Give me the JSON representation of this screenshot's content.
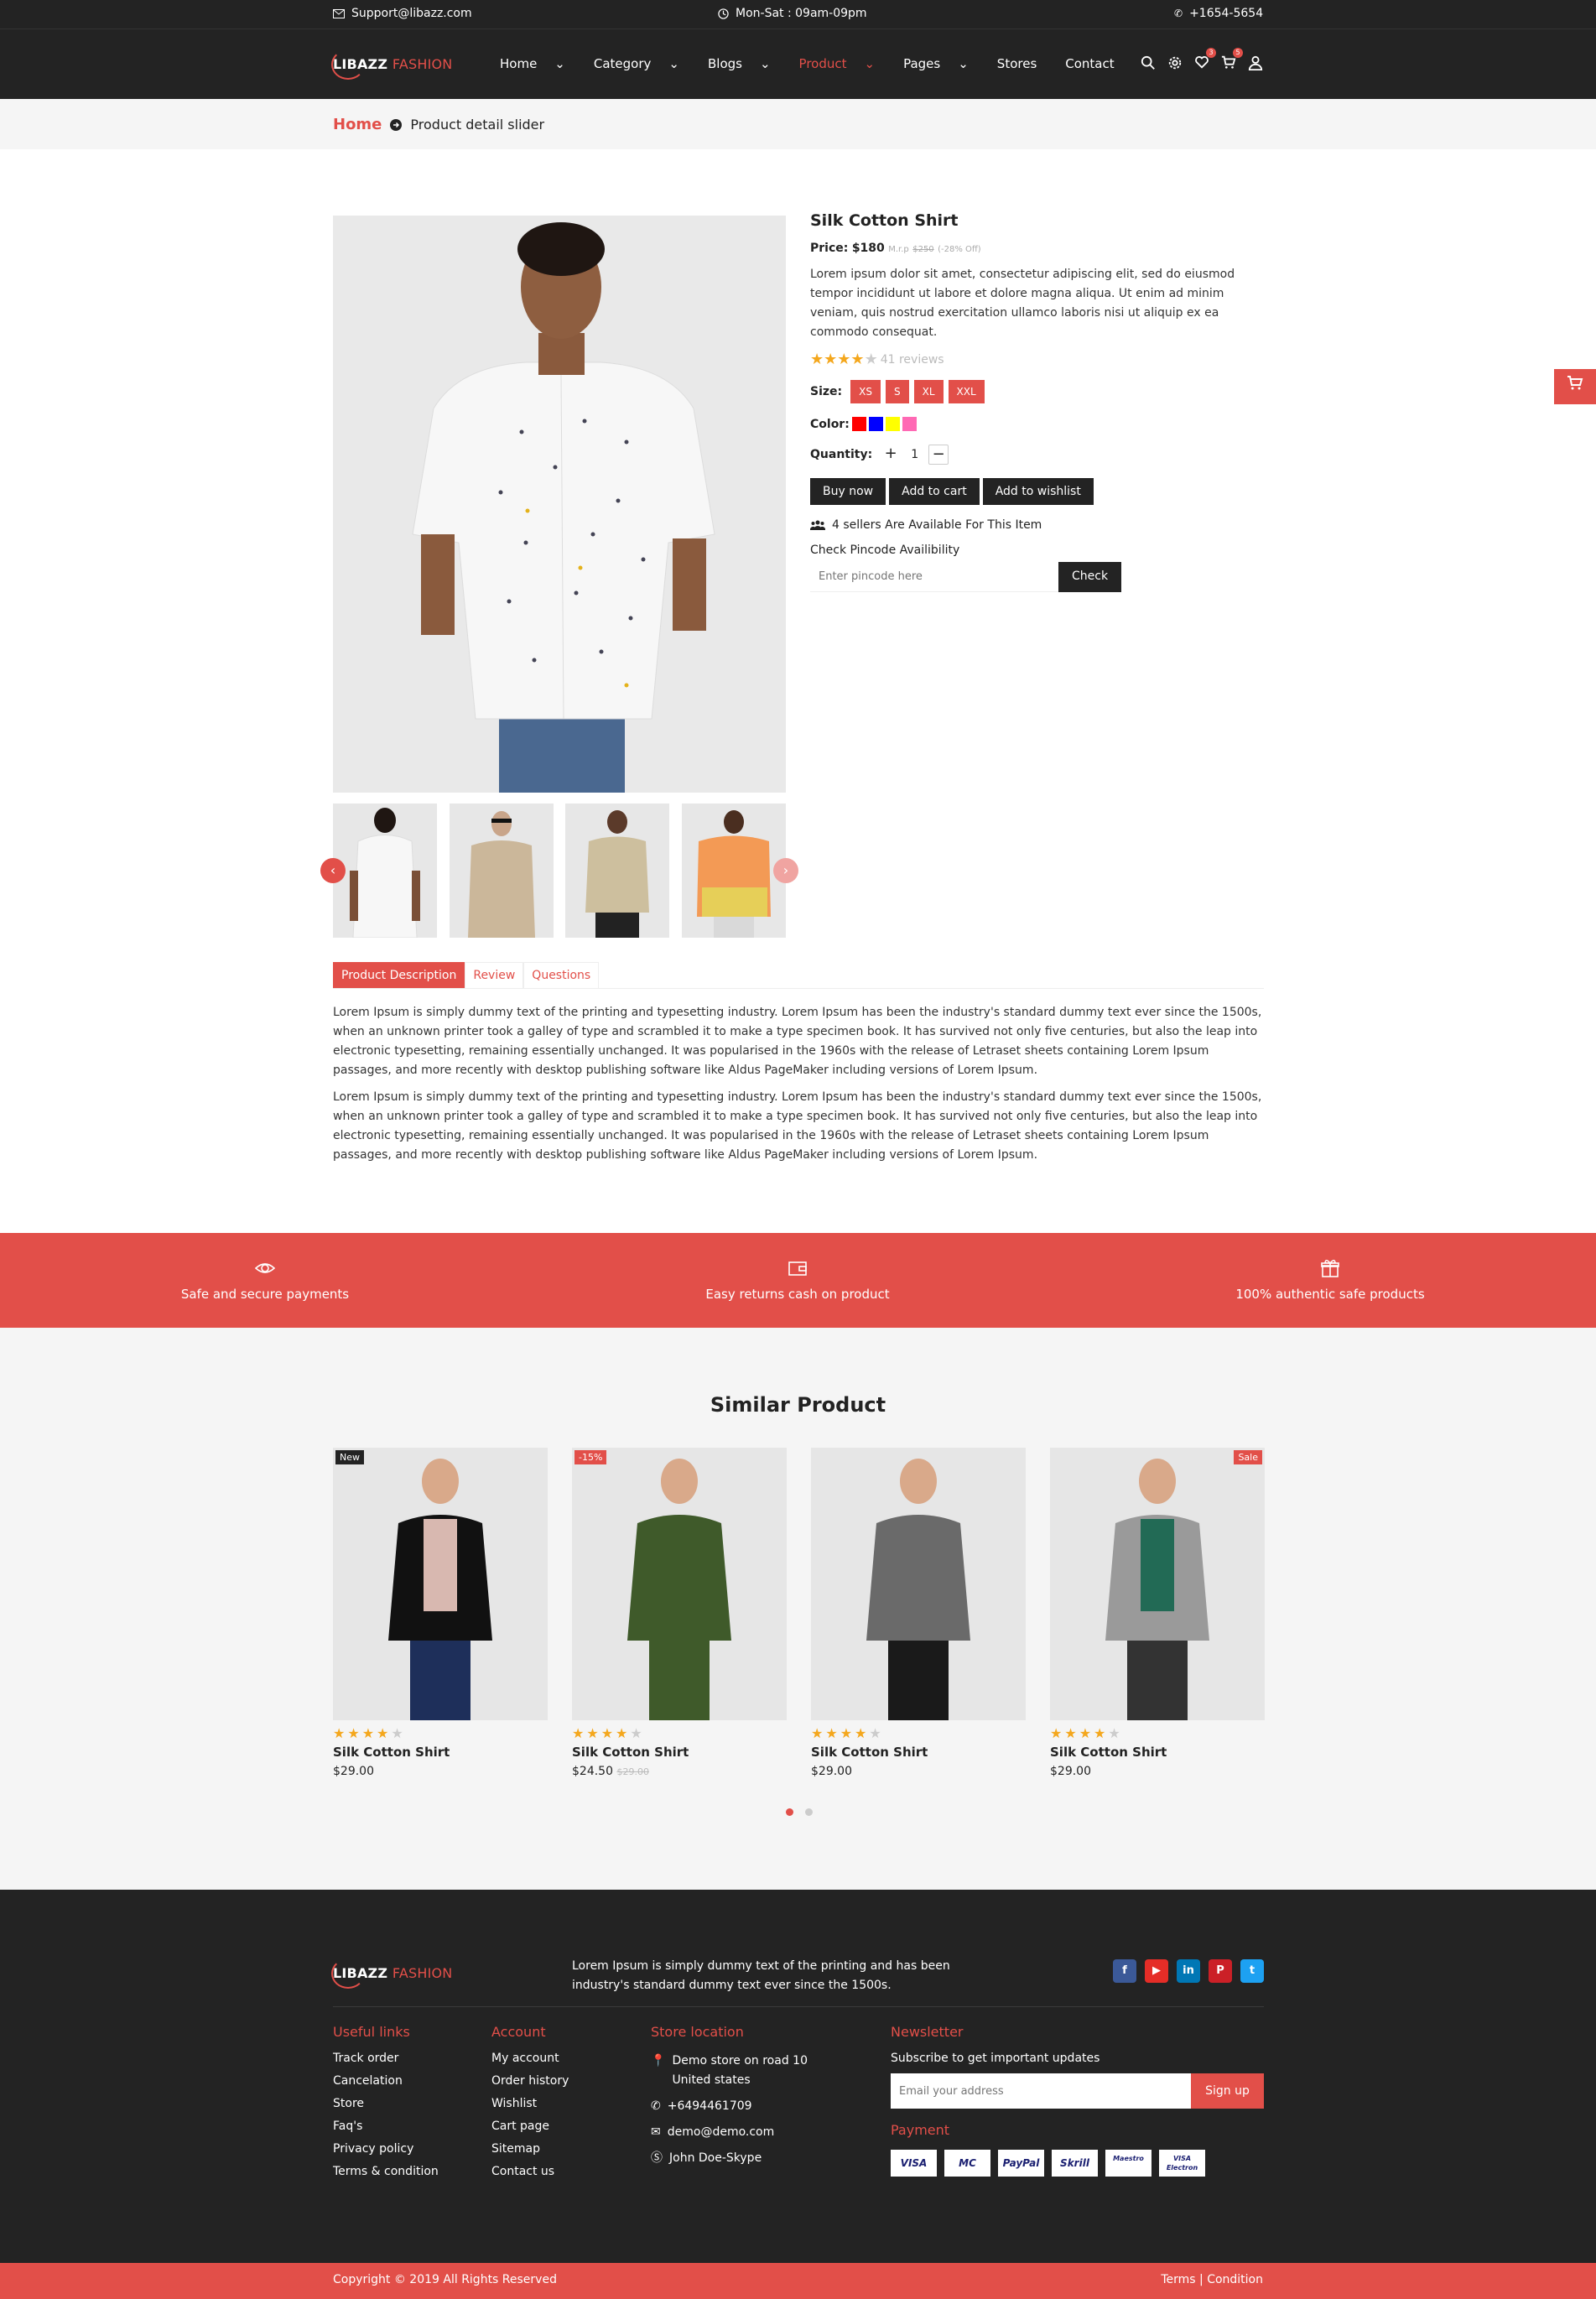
{
  "topbar": {
    "email": "Support@libazz.com",
    "hours": "Mon-Sat : 09am-09pm",
    "phone": "+1654-5654"
  },
  "header": {
    "logo_a": "LIBAZZ",
    "logo_b": "FASHION",
    "nav": [
      {
        "label": "Home",
        "dropdown": true
      },
      {
        "label": "Category",
        "dropdown": true
      },
      {
        "label": "Blogs",
        "dropdown": true
      },
      {
        "label": "Product",
        "dropdown": true,
        "active": true
      },
      {
        "label": "Pages",
        "dropdown": true
      },
      {
        "label": "Stores",
        "dropdown": false
      },
      {
        "label": "Contact",
        "dropdown": false
      }
    ],
    "wishlist_count": "3",
    "cart_count": "5"
  },
  "breadcrumb": {
    "home": "Home",
    "current": "Product detail slider"
  },
  "product": {
    "title": "Silk Cotton Shirt",
    "price_label": "Price:",
    "price": "$180",
    "mrp_label": "M.r.p",
    "old_price": "$250",
    "discount": "(-28% Off)",
    "description": "Lorem ipsum dolor sit amet, consectetur adipiscing elit, sed do eiusmod tempor incididunt ut labore et dolore magna aliqua. Ut enim ad minim veniam, quis nostrud exercitation ullamco laboris nisi ut aliquip ex ea commodo consequat.",
    "rating": 4,
    "reviews": "41 reviews",
    "size_label": "Size:",
    "sizes": [
      "XS",
      "S",
      "XL",
      "XXL"
    ],
    "color_label": "Color:",
    "colors": [
      "#ff0000",
      "#0000ff",
      "#ffff00",
      "#ff69b4"
    ],
    "quantity_label": "Quantity:",
    "quantity": "1",
    "buttons": {
      "buy": "Buy now",
      "cart": "Add to cart",
      "wishlist": "Add to wishlist"
    },
    "sellers": "4 sellers Are Available For This Item",
    "pincode_label": "Check Pincode Availibility",
    "pincode_placeholder": "Enter pincode here",
    "pincode_button": "Check"
  },
  "tabs": {
    "items": [
      "Product Description",
      "Review",
      "Questions"
    ],
    "paragraphs": [
      "Lorem Ipsum is simply dummy text of the printing and typesetting industry. Lorem Ipsum has been the industry's standard dummy text ever since the 1500s, when an unknown printer took a galley of type and scrambled it to make a type specimen book. It has survived not only five centuries, but also the leap into electronic typesetting, remaining essentially unchanged. It was popularised in the 1960s with the release of Letraset sheets containing Lorem Ipsum passages, and more recently with desktop publishing software like Aldus PageMaker including versions of Lorem Ipsum.",
      "Lorem Ipsum is simply dummy text of the printing and typesetting industry. Lorem Ipsum has been the industry's standard dummy text ever since the 1500s, when an unknown printer took a galley of type and scrambled it to make a type specimen book. It has survived not only five centuries, but also the leap into electronic typesetting, remaining essentially unchanged. It was popularised in the 1960s with the release of Letraset sheets containing Lorem Ipsum passages, and more recently with desktop publishing software like Aldus PageMaker including versions of Lorem Ipsum."
    ]
  },
  "features": [
    {
      "icon": "eye-icon",
      "label": "Safe and secure payments"
    },
    {
      "icon": "wallet-icon",
      "label": "Easy returns cash on product"
    },
    {
      "icon": "gift-icon",
      "label": "100% authentic safe products"
    }
  ],
  "similar": {
    "title": "Similar Product",
    "items": [
      {
        "tag": "New",
        "tag_color": "#232323",
        "name": "Silk Cotton Shirt",
        "price": "$29.00",
        "old": "",
        "rating": 4,
        "top": "#111111",
        "shirt": "#d8b8b0",
        "legs": "#1e2f5a"
      },
      {
        "tag": "-15%",
        "tag_color": "#e24f49",
        "name": "Silk Cotton Shirt",
        "price": "$24.50",
        "old": "$29.00",
        "rating": 4,
        "top": "#3f5a2a",
        "shirt": "#3f5a2a",
        "legs": "#3f5a2a"
      },
      {
        "tag": "",
        "tag_color": "",
        "name": "Silk Cotton Shirt",
        "price": "$29.00",
        "old": "",
        "rating": 4,
        "top": "#6a6a6a",
        "shirt": "#6a6a6a",
        "legs": "#1a1a1a"
      },
      {
        "tag": "Sale",
        "tag_color": "#e24f49",
        "name": "Silk Cotton Shirt",
        "price": "$29.00",
        "old": "",
        "rating": 4,
        "top": "#9a9a9a",
        "shirt": "#226a55",
        "legs": "#333333"
      }
    ]
  },
  "footer": {
    "logo_a": "LIBAZZ",
    "logo_b": "FASHION",
    "about": "Lorem Ipsum is simply dummy text of the printing and has been industry's standard dummy text ever since the 1500s.",
    "social": [
      {
        "icon": "facebook-icon",
        "glyph": "f",
        "color": "#3b5998"
      },
      {
        "icon": "youtube-icon",
        "glyph": "▶",
        "color": "#e52d27"
      },
      {
        "icon": "linkedin-icon",
        "glyph": "in",
        "color": "#0077b5"
      },
      {
        "icon": "pinterest-icon",
        "glyph": "P",
        "color": "#cb2027"
      },
      {
        "icon": "twitter-icon",
        "glyph": "t",
        "color": "#1da1f2"
      }
    ],
    "useful": {
      "title": "Useful links",
      "links": [
        "Track order",
        "Cancelation",
        "Store",
        "Faq's",
        "Privacy policy",
        "Terms & condition"
      ]
    },
    "account": {
      "title": "Account",
      "links": [
        "My account",
        "Order history",
        "Wishlist",
        "Cart page",
        "Sitemap",
        "Contact us"
      ]
    },
    "store": {
      "title": "Store location",
      "address": "Demo store on road 10 United states",
      "phone": "+6494461709",
      "email": "demo@demo.com",
      "skype": "John Doe-Skype"
    },
    "newsletter": {
      "title": "Newsletter",
      "subtitle": "Subscribe to get important updates",
      "placeholder": "Email your address",
      "button": "Sign up"
    },
    "payment": {
      "title": "Payment",
      "cards": [
        "VISA",
        "MC",
        "PayPal",
        "Skrill",
        "Maestro",
        "VISA Electron"
      ]
    },
    "copyright": "Copyright © 2019 All Rights Reserved",
    "terms": "Terms | Condition"
  }
}
